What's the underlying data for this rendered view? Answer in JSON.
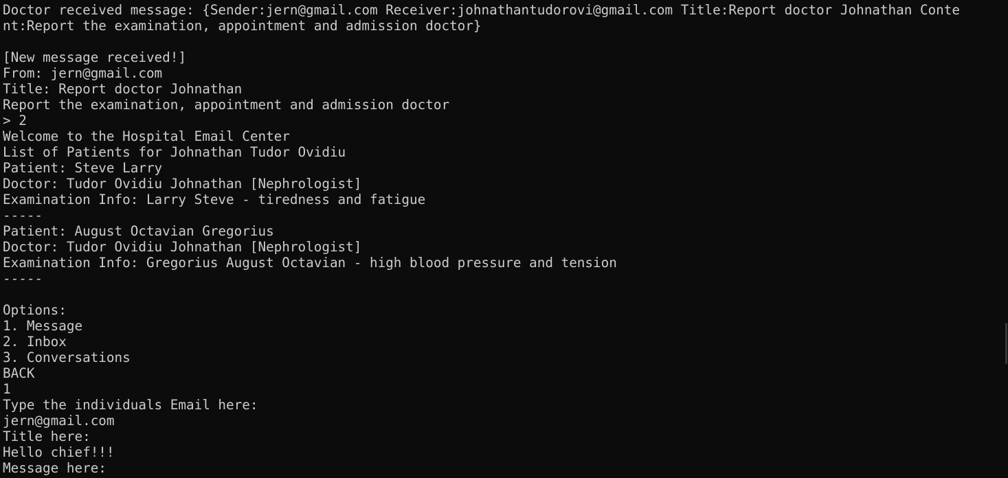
{
  "terminal": {
    "lines": [
      "Doctor received message: {Sender:jern@gmail.com Receiver:johnathantudorovi@gmail.com Title:Report doctor Johnathan Conte",
      "nt:Report the examination, appointment and admission doctor}",
      "",
      "[New message received!]",
      "From: jern@gmail.com",
      "Title: Report doctor Johnathan",
      "Report the examination, appointment and admission doctor",
      "> 2",
      "Welcome to the Hospital Email Center",
      "List of Patients for Johnathan Tudor Ovidiu",
      "Patient: Steve Larry",
      "Doctor: Tudor Ovidiu Johnathan [Nephrologist]",
      "Examination Info: Larry Steve - tiredness and fatigue",
      "-----",
      "Patient: August Octavian Gregorius",
      "Doctor: Tudor Ovidiu Johnathan [Nephrologist]",
      "Examination Info: Gregorius August Octavian - high blood pressure and tension",
      "-----",
      "",
      "Options:",
      "1. Message",
      "2. Inbox",
      "3. Conversations",
      "BACK",
      "1",
      "Type the individuals Email here:",
      "jern@gmail.com",
      "Title here:",
      "Hello chief!!!",
      "Message here:"
    ]
  }
}
